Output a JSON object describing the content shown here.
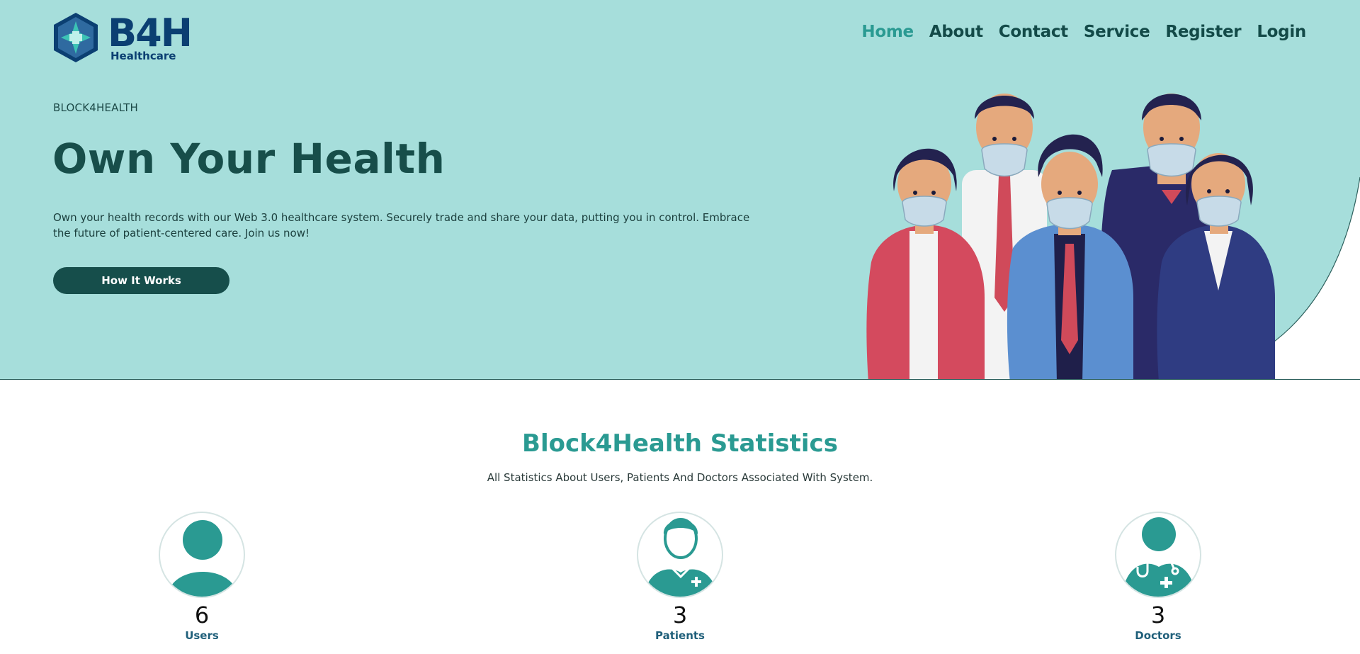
{
  "brand": {
    "name": "B4H",
    "tagline": "Healthcare",
    "colors": {
      "primary": "#0b3f72",
      "accent": "#2a9a92",
      "hero_bg": "#a6dedb",
      "dark": "#164e4b"
    }
  },
  "nav": {
    "items": [
      {
        "label": "Home",
        "active": true
      },
      {
        "label": "About",
        "active": false
      },
      {
        "label": "Contact",
        "active": false
      },
      {
        "label": "Service",
        "active": false
      },
      {
        "label": "Register",
        "active": false
      },
      {
        "label": "Login",
        "active": false
      }
    ]
  },
  "hero": {
    "eyebrow": "BLOCK4HEALTH",
    "title": "Own Your Health",
    "description": "Own your health records with our Web 3.0 healthcare system. Securely trade and share your data, putting you in control. Embrace the future of patient-centered care. Join us now!",
    "cta_label": "How It Works"
  },
  "stats": {
    "title": "Block4Health Statistics",
    "subtitle": "All Statistics About Users, Patients And Doctors Associated With System.",
    "items": [
      {
        "icon": "user-icon",
        "value": "6",
        "label": "Users"
      },
      {
        "icon": "patient-icon",
        "value": "3",
        "label": "Patients"
      },
      {
        "icon": "doctor-icon",
        "value": "3",
        "label": "Doctors"
      }
    ]
  }
}
